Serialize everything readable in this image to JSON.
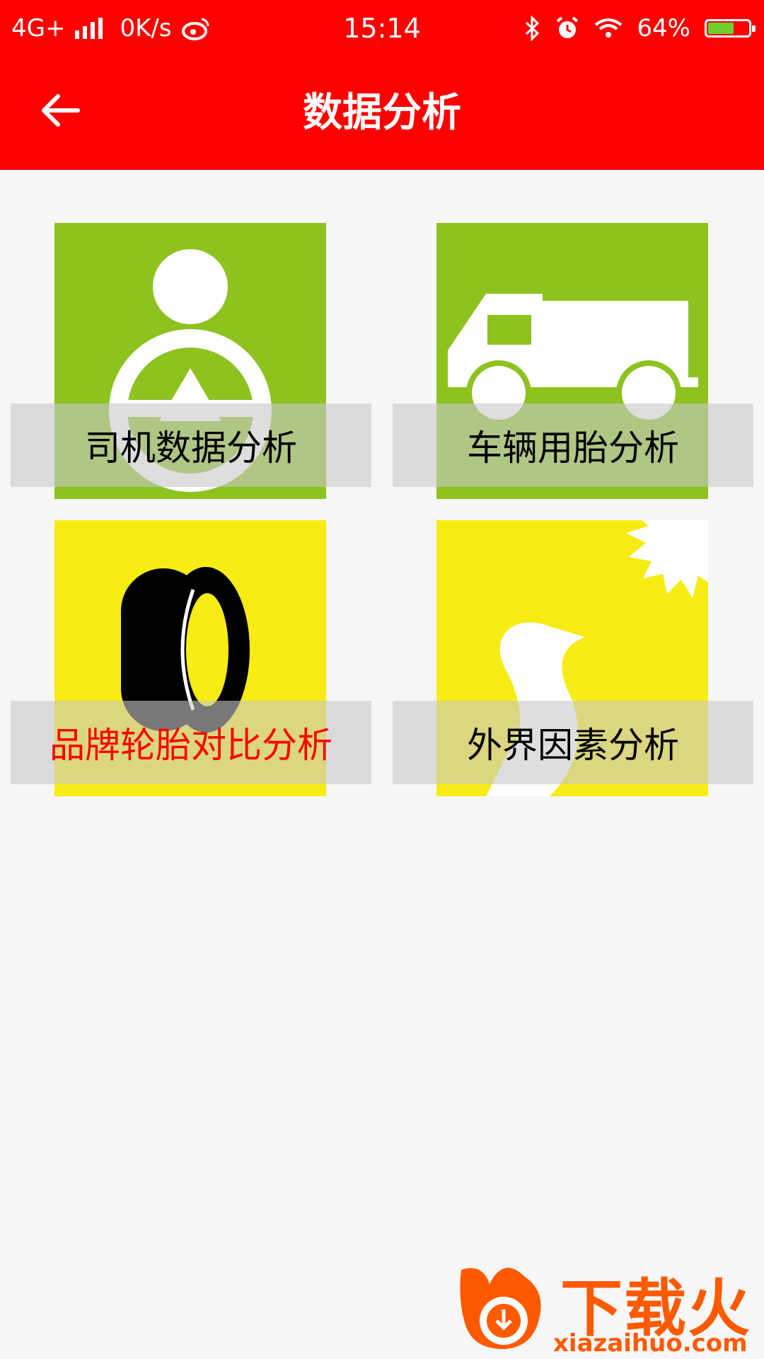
{
  "status_bar": {
    "network": "4G+",
    "speed": "0K/s",
    "time": "15:14",
    "battery": "64%",
    "battery_level": 0.64,
    "icons": [
      "signal-icon",
      "weibo-icon",
      "bluetooth-icon",
      "alarm-icon",
      "wifi-icon",
      "battery-icon"
    ]
  },
  "header": {
    "title": "数据分析",
    "back_icon": "arrow-left-icon"
  },
  "tiles": [
    {
      "label": "司机数据分析",
      "icon": "driver-icon",
      "color": "#8dc21f",
      "selected": false
    },
    {
      "label": "车辆用胎分析",
      "icon": "truck-icon",
      "color": "#8dc21f",
      "selected": false
    },
    {
      "label": "品牌轮胎对比分析",
      "icon": "tire-icon",
      "color": "#f7ec13",
      "selected": true
    },
    {
      "label": "外界因素分析",
      "icon": "road-sun-icon",
      "color": "#f7ec13",
      "selected": false
    }
  ],
  "colors": {
    "header": "#ff0000",
    "background": "#f7f7f7",
    "selected_text": "#ff0000",
    "watermark": "#ff5a00"
  },
  "watermark": {
    "text": "下载火",
    "url": "xiazaihuo.com"
  }
}
